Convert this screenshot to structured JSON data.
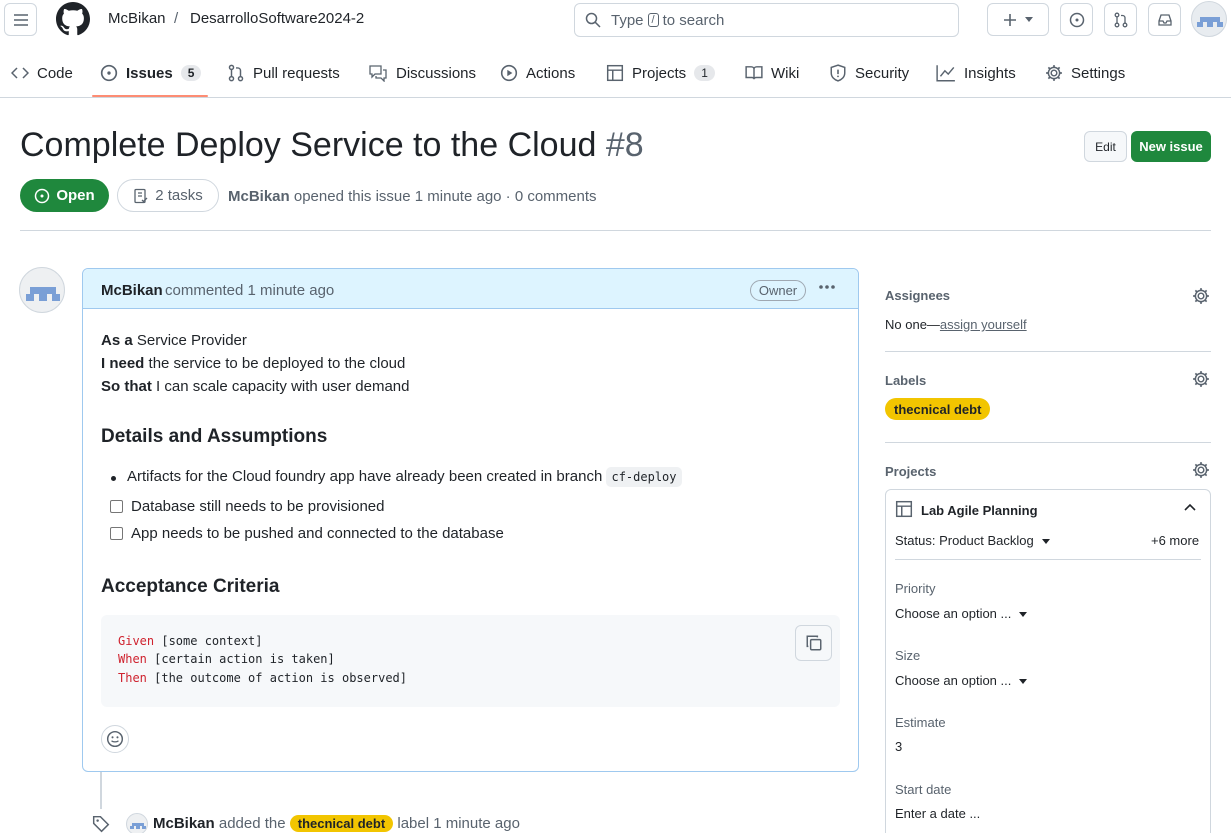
{
  "header": {
    "owner": "McBikan",
    "separator": "/",
    "repo": "DesarrolloSoftware2024-2",
    "search": {
      "prefix": "Type",
      "key": "/",
      "suffix": "to search"
    }
  },
  "repo_nav": {
    "items": [
      {
        "label": "Code",
        "icon": "code-icon"
      },
      {
        "label": "Issues",
        "icon": "issue-opened-icon",
        "count": "5",
        "selected": true
      },
      {
        "label": "Pull requests",
        "icon": "git-pull-request-icon"
      },
      {
        "label": "Discussions",
        "icon": "comment-discussion-icon"
      },
      {
        "label": "Actions",
        "icon": "play-icon"
      },
      {
        "label": "Projects",
        "icon": "table-icon",
        "count": "1"
      },
      {
        "label": "Wiki",
        "icon": "book-icon"
      },
      {
        "label": "Security",
        "icon": "shield-icon"
      },
      {
        "label": "Insights",
        "icon": "graph-icon"
      },
      {
        "label": "Settings",
        "icon": "gear-icon"
      }
    ]
  },
  "issue": {
    "title": "Complete Deploy Service to the Cloud",
    "number": "#8",
    "edit_label": "Edit",
    "new_issue_label": "New issue",
    "state": "Open",
    "tasks": "2 tasks",
    "author": "McBikan",
    "opened_text": "opened this issue 1 minute ago · 0 comments"
  },
  "comment": {
    "author": "McBikan",
    "meta": "commented 1 minute ago",
    "badge": "Owner",
    "story": [
      {
        "bold": "As a",
        "text": " Service Provider"
      },
      {
        "bold": "I need",
        "text": " the service to be deployed to the cloud"
      },
      {
        "bold": "So that",
        "text": " I can scale capacity with user demand"
      }
    ],
    "details_heading": "Details and Assumptions",
    "bullet_text": "Artifacts for the Cloud foundry app have already been created in branch",
    "bullet_code": "cf-deploy",
    "tasks": [
      "Database still needs to be provisioned",
      "App needs to be pushed and connected to the database"
    ],
    "criteria_heading": "Acceptance Criteria",
    "code_lines": [
      {
        "keyword": "Given",
        "rest": " [some context]"
      },
      {
        "keyword": "When",
        "rest": " [certain action is taken]"
      },
      {
        "keyword": "Then",
        "rest": " [the outcome of action is observed]"
      }
    ]
  },
  "event": {
    "actor": "McBikan",
    "action": "added the",
    "label": "thecnical debt",
    "suffix": "label 1 minute ago"
  },
  "sidebar": {
    "assignees_heading": "Assignees",
    "assignees_text": "No one—",
    "assign_link": "assign yourself",
    "labels_heading": "Labels",
    "label": "thecnical debt",
    "label_color": "#f2c500",
    "projects_heading": "Projects",
    "project": {
      "name": "Lab Agile Planning",
      "status": "Status: Product Backlog",
      "more": "+6 more",
      "fields": [
        {
          "label": "Priority",
          "value": "Choose an option ...",
          "dropdown": true
        },
        {
          "label": "Size",
          "value": "Choose an option ...",
          "dropdown": true
        },
        {
          "label": "Estimate",
          "value": "3",
          "dropdown": false
        },
        {
          "label": "Start date",
          "value": "Enter a date ...",
          "dropdown": false
        }
      ]
    }
  },
  "colors": {
    "accent_green": "#1f883d",
    "nav_underline": "#fd8c73",
    "comment_header": "#ddf4ff",
    "label_yellow": "#f2c500"
  }
}
